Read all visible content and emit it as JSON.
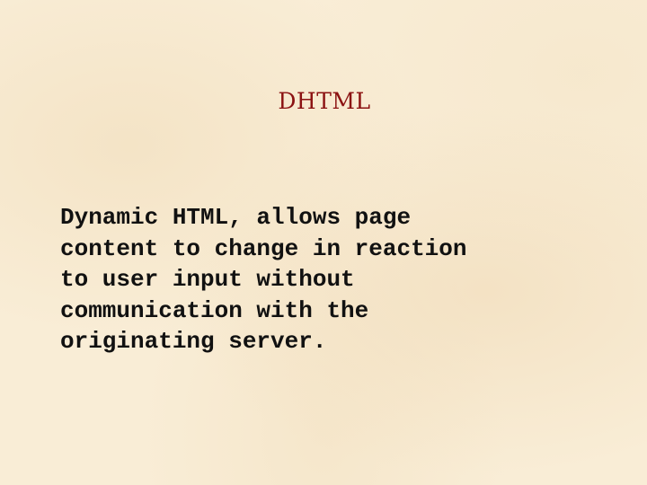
{
  "slide": {
    "title": "DHTML",
    "body_lines": [
      "Dynamic HTML, allows page",
      "content to change in reaction",
      "to user input without",
      "communication with the",
      "originating server."
    ]
  },
  "colors": {
    "background": "#f9edd6",
    "title": "#8b1212",
    "body": "#111111"
  }
}
